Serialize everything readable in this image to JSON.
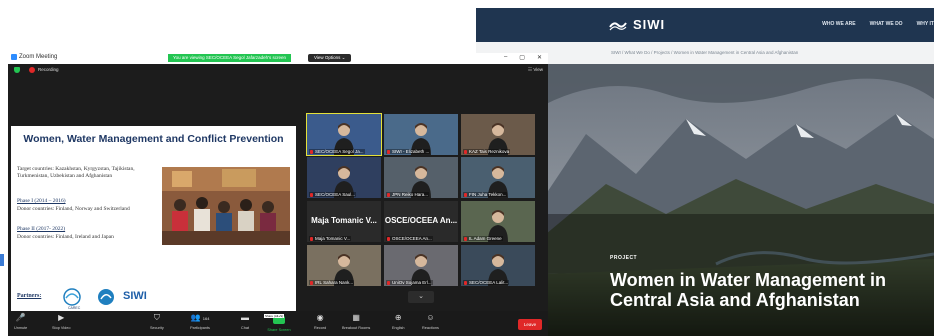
{
  "siwi": {
    "logo_text": "SIWI",
    "menu": [
      "WHO WE ARE",
      "WHAT WE DO",
      "WHY IT"
    ],
    "breadcrumb": "SIWI  /  What We Do  /  Projects  /  Women in Water Management in Central Asia and Afghanistan",
    "kicker": "PROJECT",
    "title": "Women in Water Management in Central Asia and Afghanistan"
  },
  "zoom": {
    "window_title": "Zoom Meeting",
    "share_banner": "You are viewing SEC/OCEEA Segol Jafarzadeh's screen",
    "view_options": "View Options ⌄",
    "window_controls": [
      "–",
      "▢",
      "✕"
    ],
    "recording_label": "Recording",
    "view_label": "☷ View",
    "slide": {
      "title": "Women, Water Management and Conflict Prevention",
      "target": "Target countries: Kazakhstan, Kyrgyzstan, Tajikistan, Turkmenistan, Uzbekistan and Afghanistan",
      "phase1_heading": "Phase I  (2014 – 2016)",
      "phase1_donors": "Donor countries: Finland, Norway and Switzerland",
      "phase2_heading": "Phase II (2017- 2022)",
      "phase2_donors": "Donor countries: Finland, Ireland and Japan",
      "partners_label": "Partners:",
      "carec_label": "CAREC",
      "siwi_logo": "SIWI",
      "osce_letters": [
        "O",
        "S",
        "C",
        "E"
      ],
      "osce_text": "Organization for Security and Co-operation in Europe"
    },
    "participants": [
      {
        "name": "SEC/OCEEA Segol Ja...",
        "active": true,
        "kind": "video"
      },
      {
        "name": "SIWI - Elizabeth ...",
        "active": false,
        "kind": "video"
      },
      {
        "name": "KAZ Tais Reznikova",
        "active": false,
        "kind": "video"
      },
      {
        "name": "SEC/OCEEA Saul...",
        "active": false,
        "kind": "video"
      },
      {
        "name": "JPN Reiko Hara...",
        "active": false,
        "kind": "video"
      },
      {
        "name": "FIN Juha Tekkon...",
        "active": false,
        "kind": "video"
      },
      {
        "name": "Maja Tomanic V...",
        "active": false,
        "kind": "name"
      },
      {
        "name": "OSCE/OCEEA An...",
        "active": false,
        "kind": "name"
      },
      {
        "name": "IL Adam Greene",
        "active": false,
        "kind": "video"
      },
      {
        "name": "IRL Sahara Nank...",
        "active": false,
        "kind": "video"
      },
      {
        "name": "UniOv Sojama Erl...",
        "active": false,
        "kind": "video"
      },
      {
        "name": "SEC/OCEEA Lalit...",
        "active": false,
        "kind": "video"
      }
    ],
    "scroll_down": "⌄",
    "toolbar": {
      "unmute": "Unmute",
      "stop_video": "Stop Video",
      "security": "Security",
      "participants": "Participants",
      "participants_count": "164",
      "chat": "Chat",
      "share_screen": "Share Screen",
      "share_badge": "Share (Alt+S)",
      "record": "Record",
      "breakout_rooms": "Breakout Rooms",
      "english": "English",
      "reactions": "Reactions",
      "leave": "Leave"
    }
  },
  "colors": {
    "siwi_nav": "#1f3550",
    "zoom_bg": "#1c1c1c",
    "zoom_green": "#23c552",
    "leave_red": "#e02828",
    "slide_title": "#1f3864",
    "active_speaker": "#e4e13a"
  }
}
